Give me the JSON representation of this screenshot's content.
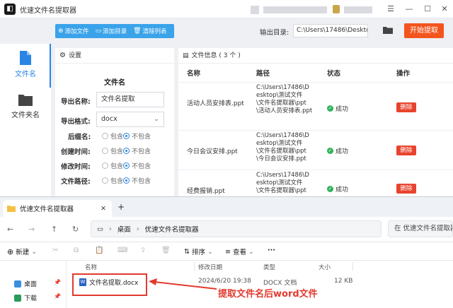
{
  "app": {
    "title": "优速文件名提取器",
    "toolbar": {
      "add_file": "添加文件",
      "add_dir": "添加目录",
      "clear": "清除列表"
    },
    "output_label": "输出目录:",
    "output_path": "C:\\Users\\17486\\Deskto",
    "start_label": "开始提取",
    "nav": [
      {
        "label": "文件名"
      },
      {
        "label": "文件夹名"
      }
    ],
    "settings": {
      "header": "设置",
      "section_title": "文件名",
      "export_name_label": "导出名称:",
      "export_name_value": "文件名提取",
      "export_format_label": "导出格式:",
      "export_format_value": "docx",
      "include": "包含",
      "exclude": "不包含",
      "options": [
        {
          "label": "后缀名:",
          "selected": "exclude"
        },
        {
          "label": "创建时间:",
          "selected": "exclude"
        },
        {
          "label": "修改时间:",
          "selected": "exclude"
        },
        {
          "label": "文件路径:",
          "selected": "exclude"
        }
      ]
    },
    "file_info": {
      "header": "文件信息 ( 3 个 )",
      "columns": {
        "name": "名称",
        "path": "路径",
        "status": "状态",
        "action": "操作"
      },
      "rows": [
        {
          "name": "活动人员安排表.ppt",
          "path": [
            "C:\\Users\\17486\\D",
            "esktop\\测试文件",
            "\\文件名提取器\\ppt",
            "\\活动人员安排表.ppt"
          ],
          "status": "成功",
          "action": "删除"
        },
        {
          "name": "今日会议安排.ppt",
          "path": [
            "C:\\Users\\17486\\D",
            "esktop\\测试文件",
            "\\文件名提取器\\ppt",
            "\\今日会议安排.ppt"
          ],
          "status": "成功",
          "action": "删除"
        },
        {
          "name": "经费报销.ppt",
          "path": [
            "C:\\Users\\17486\\D",
            "esktop\\测试文件",
            "\\文件名提取器\\ppt"
          ],
          "status": "成功",
          "action": "删除"
        }
      ]
    }
  },
  "explorer": {
    "tab_title": "优速文件名提取器",
    "breadcrumb": [
      "桌面",
      "优速文件名提取器"
    ],
    "search_placeholder": "在 优速文件名提取器",
    "new_label": "新建",
    "sort_label": "排序",
    "view_label": "查看",
    "more_label": "···",
    "columns": {
      "name": "名称",
      "modified": "修改日期",
      "type": "类型",
      "size": "大小"
    },
    "sidebar": [
      "桌面",
      "下载"
    ],
    "file": {
      "name": "文件名提取.docx",
      "modified": "2024/6/20 19:38",
      "type": "DOCX 文档",
      "size": "12 KB"
    },
    "annotation": "提取文件名后word文件"
  },
  "colors": {
    "accent_blue": "#3aa3ea",
    "start_orange": "#f3541e",
    "delete_red": "#e8432e",
    "success_green": "#2fb35a",
    "annotation_red": "#e23a2e"
  }
}
